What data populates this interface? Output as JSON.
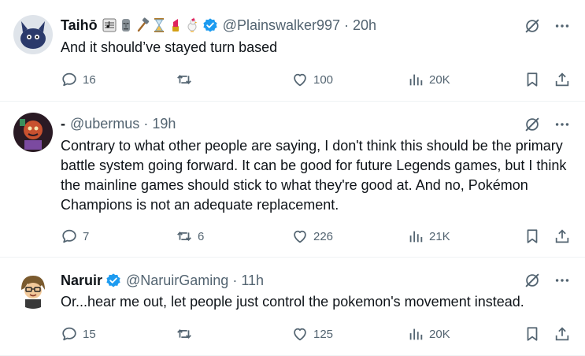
{
  "posts": [
    {
      "name": "Taihō",
      "emoji": [
        "musical-score",
        "moai",
        "hammer",
        "hourglass",
        "lipstick",
        "rooster"
      ],
      "verified": true,
      "handle": "@Plainswalker997",
      "time": "20h",
      "text": "And it should’ve stayed turn based",
      "replies": "16",
      "reposts": "",
      "likes": "100",
      "views": "20K"
    },
    {
      "name": "-",
      "verified": false,
      "handle": "@ubermus",
      "time": "19h",
      "text": "Contrary to what other people are saying, I don't think this should be the primary battle system going forward. It can be good for future Legends games, but I think the mainline games should stick to what they're good at. And no, Pokémon Champions is not an adequate replacement.",
      "replies": "7",
      "reposts": "6",
      "likes": "226",
      "views": "21K"
    },
    {
      "name": "Naruir",
      "verified": true,
      "handle": "@NaruirGaming",
      "time": "11h",
      "text": "Or...hear me out, let people just control the pokemon's movement instead.",
      "replies": "15",
      "reposts": "",
      "likes": "125",
      "views": "20K"
    }
  ],
  "colors": {
    "text": "#0f1419",
    "secondary": "#536471",
    "verified": "#1d9bf0",
    "divider": "#eff3f4"
  },
  "icons": {
    "reply": "speech-bubble-icon",
    "repost": "repost-arrows-icon",
    "like": "heart-icon",
    "views": "bar-chart-icon",
    "bookmark": "bookmark-icon",
    "share": "share-upload-icon",
    "grok": "grok-slash-circle-icon",
    "more": "more-dots-icon"
  }
}
